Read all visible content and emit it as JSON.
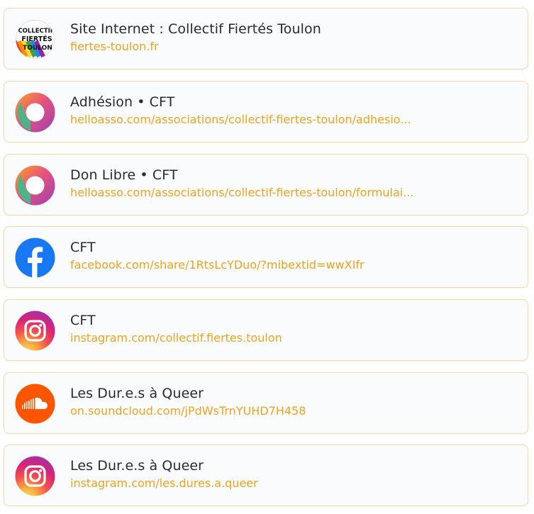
{
  "links": [
    {
      "title": "Site Internet : Collectif Fiertés Toulon",
      "url": "fiertes-toulon.fr",
      "icon": "collectif-fiertes-toulon-logo",
      "logo_lines": [
        "COLLECTIF",
        "FIERTÉS",
        "TOULON"
      ]
    },
    {
      "title": "Adhésion • CFT",
      "url": "helloasso.com/associations/collectif-fiertes-toulon/adhesio...",
      "icon": "helloasso-icon"
    },
    {
      "title": "Don Libre • CFT",
      "url": "helloasso.com/associations/collectif-fiertes-toulon/formulai...",
      "icon": "helloasso-icon"
    },
    {
      "title": "CFT",
      "url": "facebook.com/share/1RtsLcYDuo/?mibextid=wwXIfr",
      "icon": "facebook-icon"
    },
    {
      "title": "CFT",
      "url": "instagram.com/collectif.fiertes.toulon",
      "icon": "instagram-icon"
    },
    {
      "title": "Les Dur.e.s à Queer",
      "url": "on.soundcloud.com/jPdWsTrnYUHD7H458",
      "icon": "soundcloud-icon"
    },
    {
      "title": "Les Dur.e.s à Queer",
      "url": "instagram.com/les.dures.a.queer",
      "icon": "instagram-icon"
    }
  ],
  "colors": {
    "accent": "#efa21b",
    "card_border": "#f3d9a4",
    "title_text": "#2b2b2b",
    "facebook": "#1877f2",
    "soundcloud": "#ff5500"
  }
}
